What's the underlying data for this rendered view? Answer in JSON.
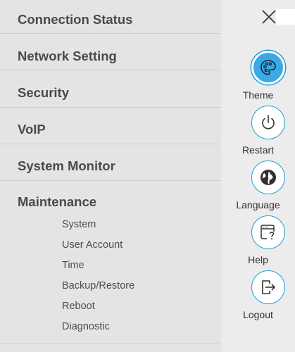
{
  "menu": {
    "items": [
      {
        "label": "Connection Status"
      },
      {
        "label": "Network Setting"
      },
      {
        "label": "Security"
      },
      {
        "label": "VoIP"
      },
      {
        "label": "System Monitor"
      },
      {
        "label": "Maintenance"
      }
    ],
    "maintenance_sub": [
      {
        "label": "System"
      },
      {
        "label": "User Account"
      },
      {
        "label": "Time"
      },
      {
        "label": "Backup/Restore"
      },
      {
        "label": "Reboot"
      },
      {
        "label": "Diagnostic"
      }
    ]
  },
  "actions": [
    {
      "label": "Theme",
      "icon": "palette-icon"
    },
    {
      "label": "Restart",
      "icon": "power-icon"
    },
    {
      "label": "Language",
      "icon": "globe-icon"
    },
    {
      "label": "Help",
      "icon": "help-window-icon"
    },
    {
      "label": "Logout",
      "icon": "logout-icon"
    }
  ],
  "colors": {
    "accent": "#1c9fd6",
    "active_fill": "#3aa9e6"
  }
}
